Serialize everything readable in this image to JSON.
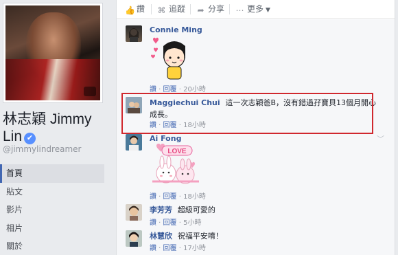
{
  "profile": {
    "name": "林志穎 Jimmy Lin",
    "handle": "@jimmylindreamer",
    "verified_icon": "verified-badge-icon"
  },
  "nav": {
    "items": [
      {
        "label": "首頁",
        "active": true
      },
      {
        "label": "貼文",
        "active": false
      },
      {
        "label": "影片",
        "active": false
      },
      {
        "label": "相片",
        "active": false
      },
      {
        "label": "關於",
        "active": false
      }
    ]
  },
  "actions": {
    "like": "讚",
    "follow": "追蹤",
    "share": "分享",
    "more": "更多"
  },
  "comments": [
    {
      "name": "Connie Ming",
      "text": "",
      "has_sticker": true,
      "sticker": "girl-hearts-sticker",
      "like": "讚",
      "reply": "回覆",
      "time": "20小時"
    },
    {
      "name": "Maggiechui Chui",
      "text": "這一次志穎爸B，沒有錯過孖寶貝13個月開心成長。",
      "has_sticker": false,
      "like": "讚",
      "reply": "回覆",
      "time": "18小時"
    },
    {
      "name": "Ai Fong",
      "text": "",
      "has_sticker": true,
      "sticker": "bunnies-love-sticker",
      "sticker_text": "LOVE",
      "like": "讚",
      "reply": "回覆",
      "time": "18小時"
    },
    {
      "name": "李芳芳",
      "text": "超級可愛的",
      "has_sticker": false,
      "like": "讚",
      "reply": "回覆",
      "time": "5小時"
    },
    {
      "name": "林慧欣",
      "text": "祝福平安唷！",
      "has_sticker": false,
      "like": "讚",
      "reply": "回覆",
      "time": "17小時"
    }
  ],
  "colors": {
    "link": "#365899",
    "highlight": "#d0282e",
    "background": "#e9ebee"
  }
}
